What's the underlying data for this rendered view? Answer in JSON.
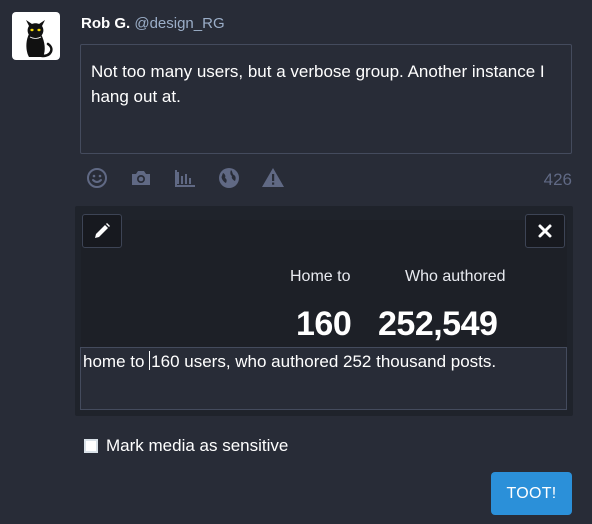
{
  "user": {
    "display_name": "Rob G.",
    "acct": "@design_RG",
    "avatar_icon": "black-cat-avatar"
  },
  "compose": {
    "text": "Not too many users, but a verbose group. Another instance I hang out at.",
    "char_counter": "426"
  },
  "toolbar": {
    "icons": [
      "emoji-icon",
      "camera-icon",
      "poll-icon",
      "globe-icon",
      "warning-icon"
    ]
  },
  "media": {
    "image": {
      "labels": [
        "Home to",
        "Who authored"
      ],
      "numbers": [
        "160",
        "252,549"
      ]
    },
    "edit_icon": "pencil-icon",
    "remove_icon": "close-icon",
    "description_before_caret": "home to ",
    "description_after_caret": "160 users, who authored 252 thousand posts."
  },
  "sensitive": {
    "label": "Mark media as sensitive",
    "checked": false
  },
  "submit": {
    "label": "TOOT!"
  },
  "colors": {
    "background": "#282c37",
    "accent": "#2b90d9",
    "muted": "#606984",
    "secondary": "#9baec8"
  }
}
